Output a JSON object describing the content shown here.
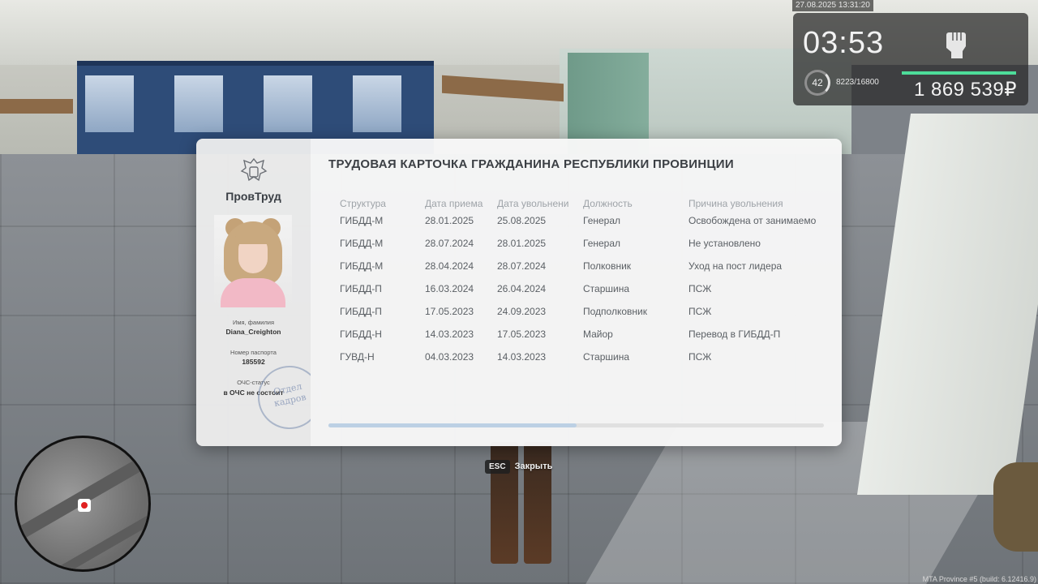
{
  "hud": {
    "datetime": "27.08.2025 13:31:20",
    "timer": "03:53",
    "level": "42",
    "xp": "8223/16800",
    "money": "1 869 539₽",
    "icon": "raised-fist-icon"
  },
  "card": {
    "org_name": "ПровТруд",
    "title": "ТРУДОВАЯ КАРТОЧКА ГРАЖДАНИНА РЕСПУБЛИКИ ПРОВИНЦИИ",
    "name_label": "Имя, фамилия",
    "name_value": "Diana_Creighton",
    "passport_label": "Номер паспорта",
    "passport_value": "185592",
    "ochs_label": "ОЧС-статус",
    "ochs_value": "в ОЧС не состоит",
    "stamp_line1": "Отдел",
    "stamp_line2": "кадров",
    "columns": [
      "Структура",
      "Дата приема",
      "Дата увольнени",
      "Должность",
      "Причина увольнения"
    ],
    "rows": [
      [
        "ГИБДД-М",
        "28.01.2025",
        "25.08.2025",
        "Генерал",
        "Освобождена от занимаемо"
      ],
      [
        "ГИБДД-М",
        "28.07.2024",
        "28.01.2025",
        "Генерал",
        "Не установлено"
      ],
      [
        "ГИБДД-М",
        "28.04.2024",
        "28.07.2024",
        "Полковник",
        "Уход на пост лидера"
      ],
      [
        "ГИБДД-П",
        "16.03.2024",
        "26.04.2024",
        "Старшина",
        "ПСЖ"
      ],
      [
        "ГИБДД-П",
        "17.05.2023",
        "24.09.2023",
        "Подполковник",
        "ПСЖ"
      ],
      [
        "ГИБДД-Н",
        "14.03.2023",
        "17.05.2023",
        "Майор",
        "Перевод в ГИБДД-П"
      ],
      [
        "ГУВД-Н",
        "04.03.2023",
        "14.03.2023",
        "Старшина",
        "ПСЖ"
      ]
    ],
    "scroll_position": 0.5
  },
  "footer": {
    "esc_key": "ESC",
    "close_label": "Закрыть"
  },
  "build_info": "MTA Province #5 (build: 6.12416.9)"
}
